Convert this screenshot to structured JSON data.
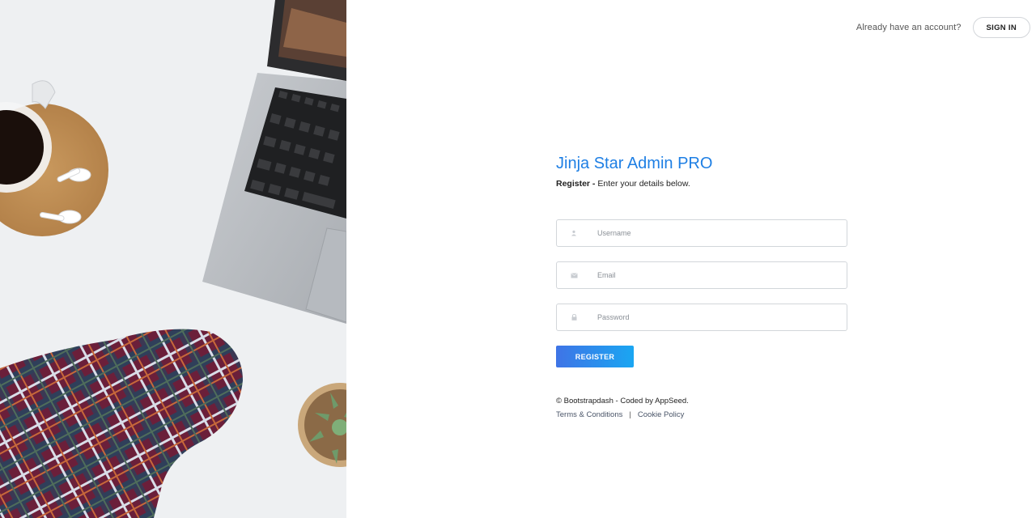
{
  "header": {
    "prompt": "Already have an account?",
    "signin_label": "SIGN IN"
  },
  "form": {
    "brand": "Jinja Star Admin PRO",
    "subtitle_strong": "Register -",
    "subtitle_rest": " Enter your details below.",
    "fields": [
      {
        "icon": "user-icon",
        "placeholder": "Username"
      },
      {
        "icon": "envelope-icon",
        "placeholder": "Email"
      },
      {
        "icon": "lock-icon",
        "placeholder": "Password"
      }
    ],
    "register_label": "REGISTER"
  },
  "footer": {
    "copyright": "© Bootstrapdash - Coded by AppSeed.",
    "terms": "Terms & Conditions",
    "separator": "|",
    "cookie": "Cookie Policy"
  },
  "colors": {
    "brand": "#1e7fe4",
    "button_gradient_start": "#3f74e6",
    "button_gradient_end": "#1aa6f2"
  }
}
